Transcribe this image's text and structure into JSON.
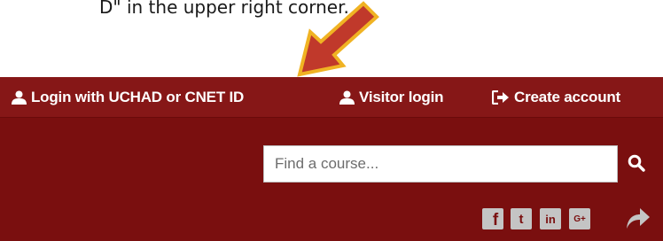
{
  "instruction": {
    "text": "D\" in the upper right corner."
  },
  "topbar": {
    "login_uchad": "Login with UCHAD or CNET ID",
    "visitor_login": "Visitor login",
    "create_account": "Create account"
  },
  "search": {
    "placeholder": "Find a course..."
  },
  "social": {
    "icons": [
      "facebook-icon",
      "twitter-icon",
      "linkedin-icon",
      "google-plus-icon",
      "share-icon"
    ],
    "facebook_glyph": "f",
    "twitter_glyph": "t",
    "linkedin_glyph": "in",
    "googleplus_glyph": "G+"
  },
  "colors": {
    "header_bg": "#7a0f0f",
    "topbar_bg": "#861717",
    "arrow_fill": "#c0392b",
    "arrow_outline": "#f0b323",
    "social_icon": "#c4c4c4"
  }
}
